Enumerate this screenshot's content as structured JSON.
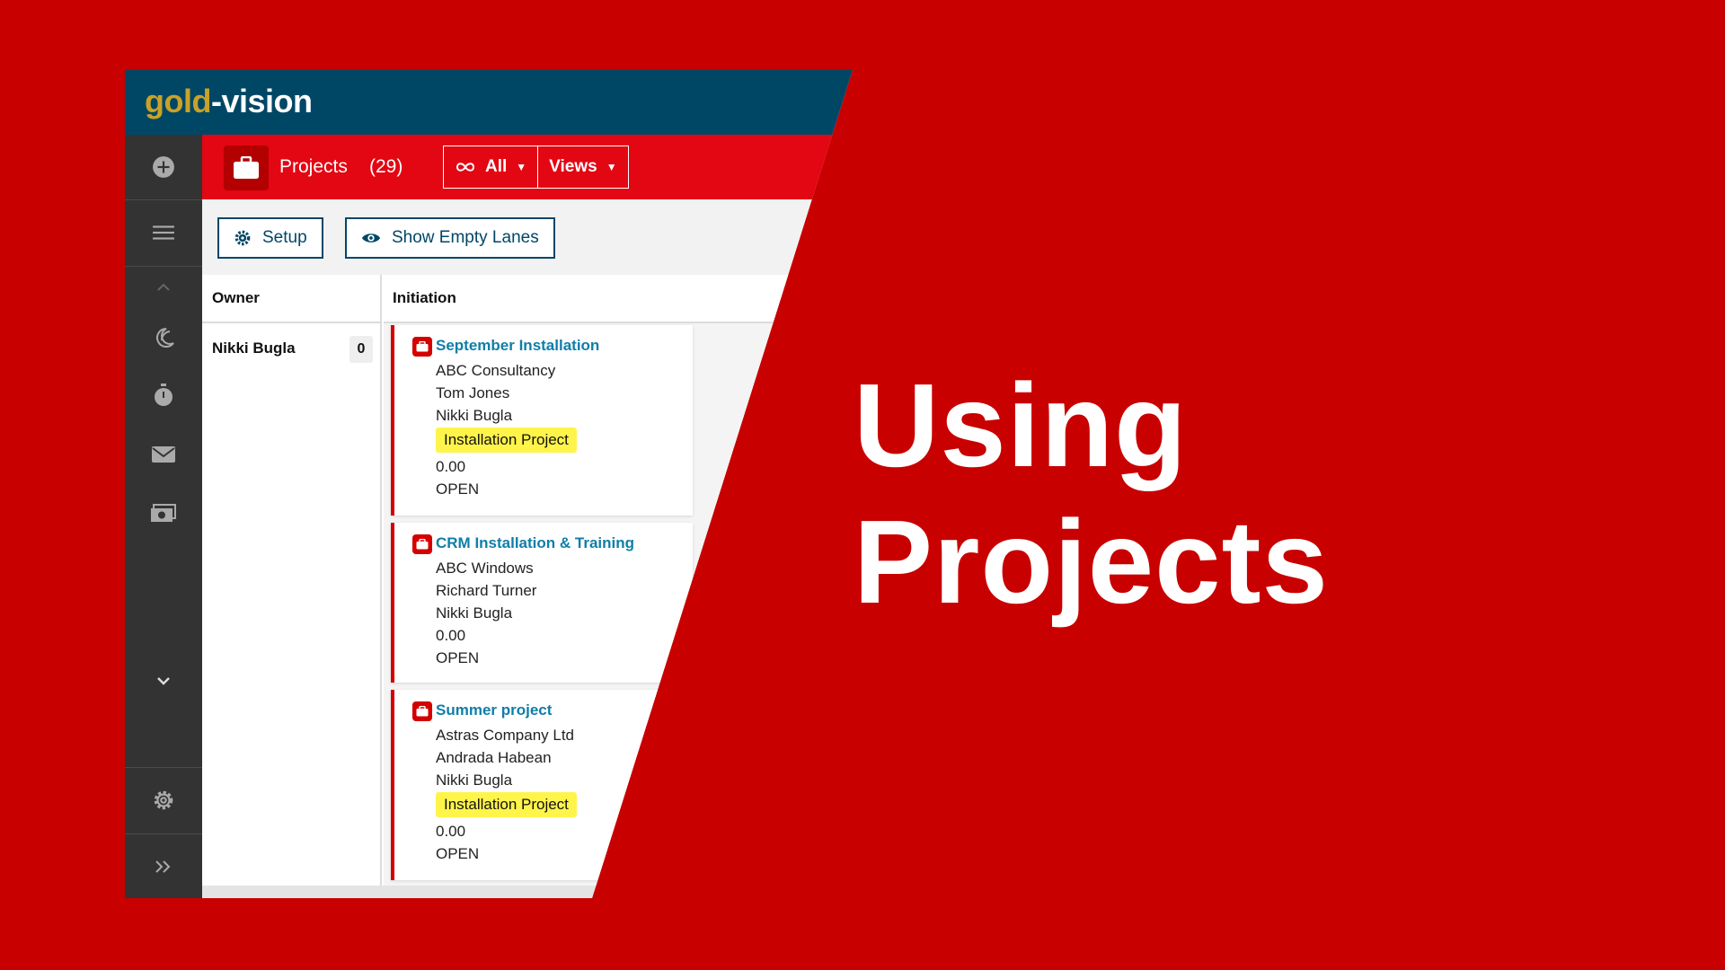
{
  "logo": {
    "part1": "gold",
    "part2": "-vision"
  },
  "header": {
    "title": "Projects",
    "count": "(29)",
    "filter_label": "All",
    "views_label": "Views"
  },
  "toolbar": {
    "setup_label": "Setup",
    "show_empty_label": "Show Empty Lanes"
  },
  "board": {
    "owner_header": "Owner",
    "lane_header": "Initiation",
    "owner": {
      "name": "Nikki Bugla",
      "count": "0"
    },
    "cards": [
      {
        "title": "September Installation",
        "company": "ABC Consultancy",
        "contact": "Tom Jones",
        "owner": "Nikki Bugla",
        "tag": "Installation Project",
        "value": "0.00",
        "status": "OPEN"
      },
      {
        "title": "CRM Installation & Training",
        "company": "ABC Windows",
        "contact": "Richard Turner",
        "owner": "Nikki Bugla",
        "value": "0.00",
        "status": "OPEN"
      },
      {
        "title": "Summer project",
        "company": "Astras Company Ltd",
        "contact": "Andrada Habean",
        "owner": "Nikki Bugla",
        "tag": "Installation Project",
        "value": "0.00",
        "status": "OPEN"
      }
    ]
  },
  "headline": {
    "line1": "Using",
    "line2": "Projects"
  },
  "colors": {
    "background": "#c80000",
    "topbar": "#004766",
    "header_red": "#e30613",
    "sidebar": "#333333",
    "link": "#0f7ea8",
    "tag": "#fff44a",
    "card_accent": "#d40000",
    "logo_gold": "#c9a227"
  },
  "icons": {
    "sidebar": [
      "plus-circle-icon",
      "hamburger-icon",
      "chevron-up-icon",
      "moon-icon",
      "stopwatch-icon",
      "envelope-icon",
      "money-icon",
      "chevron-down-icon",
      "gear-icon",
      "double-chevron-right-icon"
    ],
    "header": [
      "briefcase-icon",
      "infinity-icon",
      "caret-down-icon"
    ],
    "toolbar": [
      "gear-icon",
      "eye-icon"
    ]
  }
}
